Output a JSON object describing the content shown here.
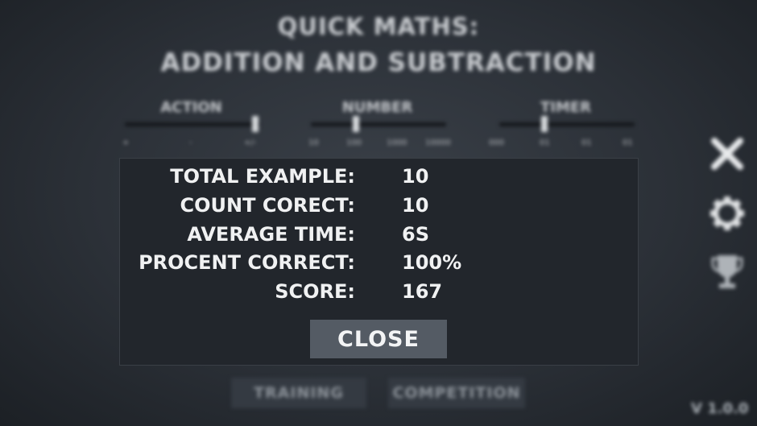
{
  "title": {
    "line1": "QUICK MATHS:",
    "line2": "ADDITION AND SUBTRACTION"
  },
  "sliders": [
    {
      "label": "ACTION",
      "level": 0.95
    },
    {
      "label": "NUMBER",
      "level": 0.35
    },
    {
      "label": "TIMER",
      "level": 0.35
    }
  ],
  "tick_labels": [
    "+",
    "-",
    "+/-",
    "10",
    "100",
    "1000",
    "10000",
    "000",
    "01",
    "01",
    "01"
  ],
  "results": {
    "total_example_label": "TOTAL EXAMPLE:",
    "total_example_value": "10",
    "count_correct_label": "COUNT CORECT:",
    "count_correct_value": "10",
    "average_time_label": "AVERAGE TIME:",
    "average_time_value": "6S",
    "percent_correct_label": "PROCENT CORRECT:",
    "percent_correct_value": "100%",
    "score_label": "SCORE:",
    "score_value": "167"
  },
  "close_label": "CLOSE",
  "menu": {
    "training": "TRAINING",
    "competition": "COMPETITION"
  },
  "version": "V 1.0.0",
  "icons": [
    "close-icon",
    "gear-icon",
    "trophy-icon"
  ]
}
